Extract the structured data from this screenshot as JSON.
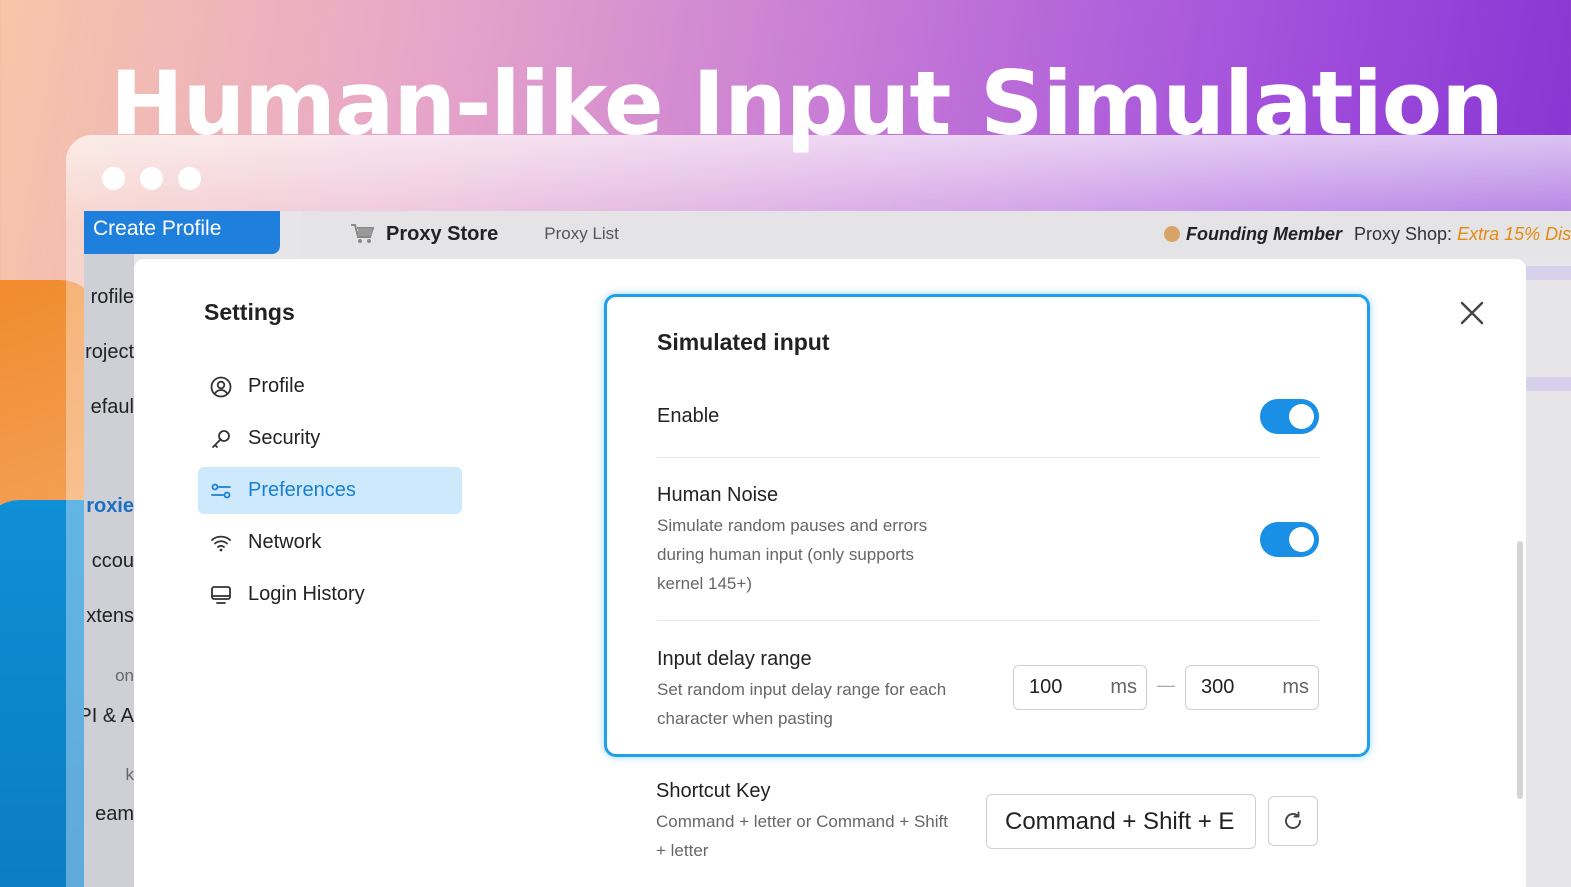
{
  "hero": {
    "title": "Human-like Input Simulation"
  },
  "app": {
    "create_profile": "Create Profile",
    "nav_items": [
      "rofile",
      "roject",
      "efaul",
      "roxie",
      "ccou",
      "xtens",
      "on",
      "PI & A",
      "k",
      "eam"
    ],
    "topbar": {
      "proxy_store": "Proxy Store",
      "proxy_list": "Proxy List",
      "founding_member": "Founding Member",
      "proxy_shop_prefix": "Proxy Shop: ",
      "proxy_shop_offer": "Extra 15% Dis"
    }
  },
  "settings": {
    "title": "Settings",
    "menu": [
      {
        "label": "Profile",
        "icon": "user-circle-icon"
      },
      {
        "label": "Security",
        "icon": "key-icon"
      },
      {
        "label": "Preferences",
        "icon": "sliders-icon",
        "active": true
      },
      {
        "label": "Network",
        "icon": "wifi-icon"
      },
      {
        "label": "Login History",
        "icon": "monitor-icon"
      }
    ],
    "simulated_input": {
      "title": "Simulated input",
      "enable_label": "Enable",
      "enable_on": true,
      "human_noise_label": "Human Noise",
      "human_noise_desc_1": "Simulate random pauses and errors",
      "human_noise_desc_2": "during human input (only supports",
      "human_noise_desc_3": "kernel 145+)",
      "human_noise_on": true,
      "delay_label": "Input delay range",
      "delay_desc_1": "Set random input delay range for each",
      "delay_desc_2": "character when pasting",
      "delay_min": "100",
      "delay_max": "300",
      "unit": "ms",
      "separator": "—"
    },
    "shortcut": {
      "label": "Shortcut Key",
      "desc_1": "Command + letter or Command + Shift",
      "desc_2": "+ letter",
      "value": "Command + Shift + E"
    }
  },
  "colors": {
    "accent": "#1a8fe6",
    "active_bg": "#cde9fb",
    "offer": "#e58a0c"
  }
}
